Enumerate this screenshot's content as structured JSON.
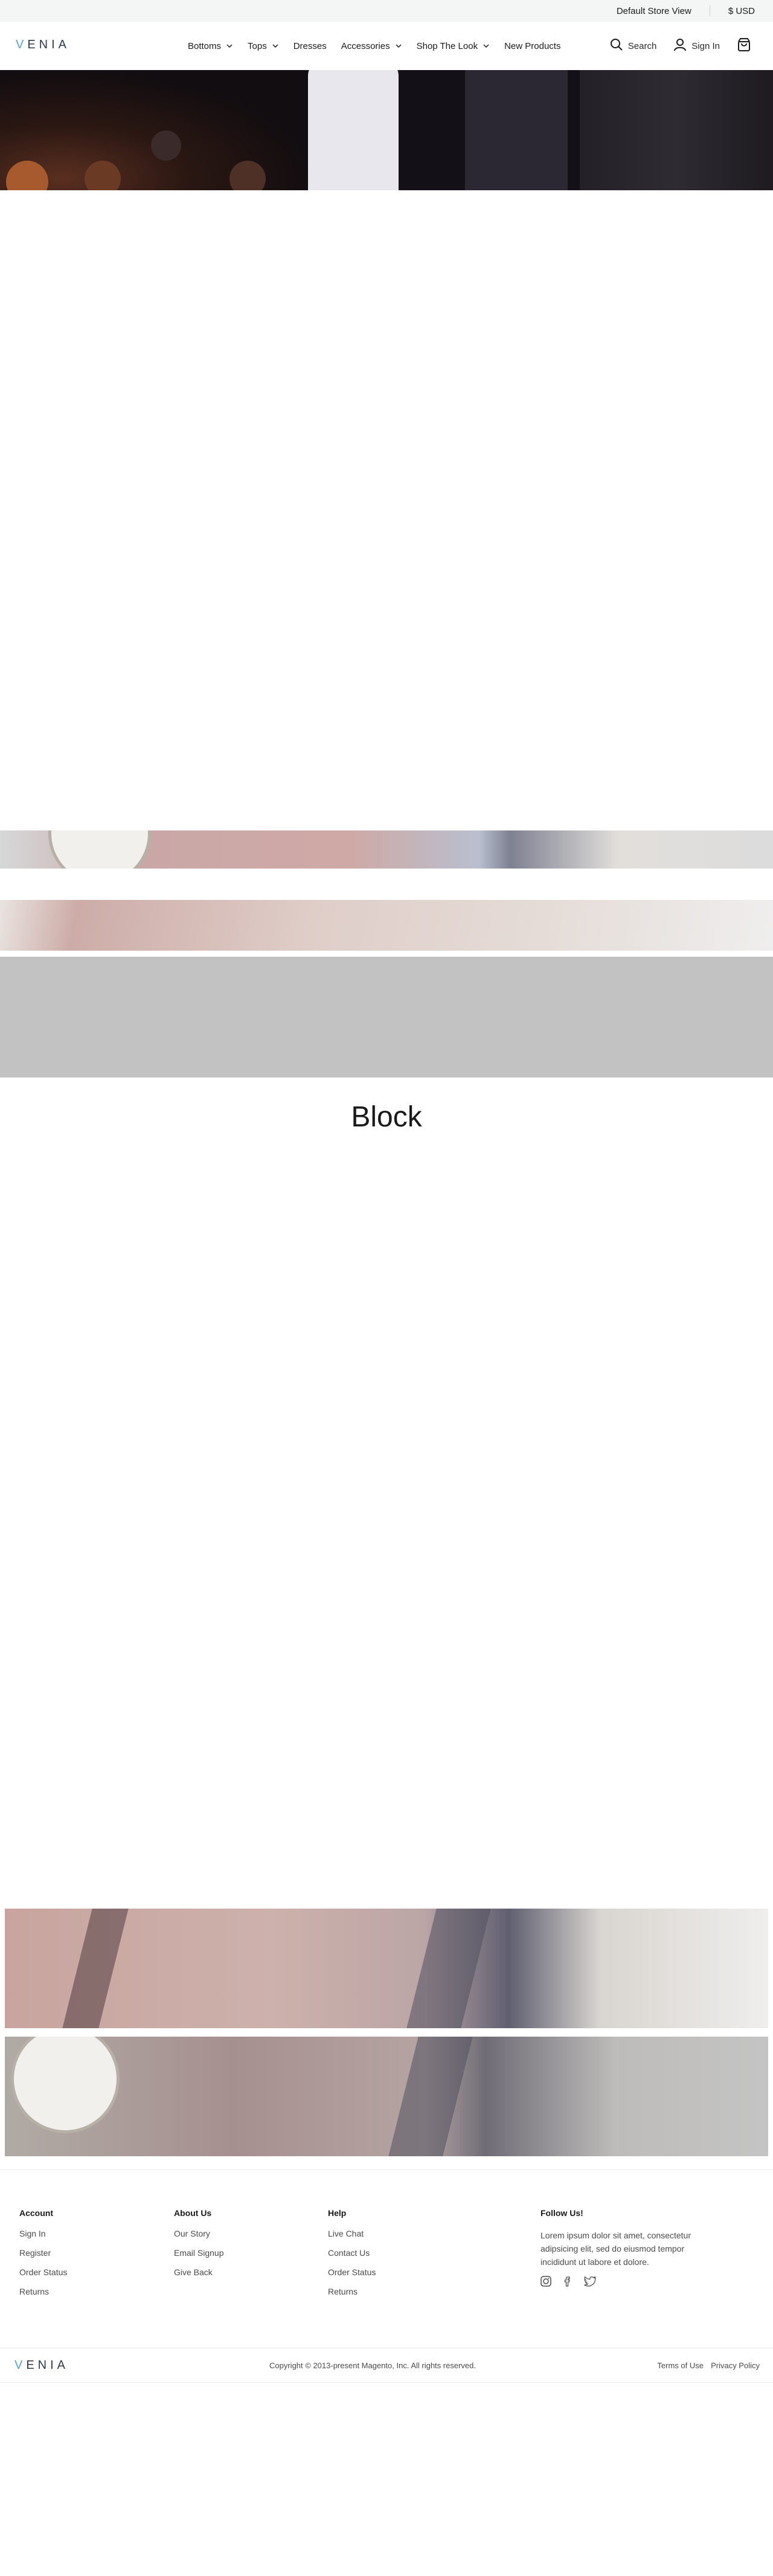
{
  "topbar": {
    "store_view": "Default Store View",
    "currency": "$ USD"
  },
  "header": {
    "logo": "VENIA",
    "nav": [
      {
        "label": "Bottoms",
        "has_dropdown": true
      },
      {
        "label": "Tops",
        "has_dropdown": true
      },
      {
        "label": "Dresses",
        "has_dropdown": false
      },
      {
        "label": "Accessories",
        "has_dropdown": true
      },
      {
        "label": "Shop The Look",
        "has_dropdown": true
      },
      {
        "label": "New Products",
        "has_dropdown": false
      }
    ],
    "search_label": "Search",
    "signin_label": "Sign In",
    "icons": [
      "search-icon",
      "user-icon",
      "shopping-bag-icon",
      "chevron-down-icon"
    ]
  },
  "main": {
    "block_title": "Block"
  },
  "footer": {
    "columns": [
      {
        "heading": "Account",
        "links": [
          "Sign In",
          "Register",
          "Order Status",
          "Returns"
        ]
      },
      {
        "heading": "About Us",
        "links": [
          "Our Story",
          "Email Signup",
          "Give Back"
        ]
      },
      {
        "heading": "Help",
        "links": [
          "Live Chat",
          "Contact Us",
          "Order Status",
          "Returns"
        ]
      }
    ],
    "follow": {
      "heading": "Follow Us!",
      "text": "Lorem ipsum dolor sit amet, consectetur adipsicing elit, sed do eiusmod tempor incididunt ut labore et dolore.",
      "icons": [
        "instagram-icon",
        "facebook-icon",
        "twitter-icon"
      ]
    },
    "logo": "VENIA",
    "copyright": "Copyright © 2013-present Magento, Inc. All rights reserved.",
    "terms": "Terms of Use",
    "privacy": "Privacy Policy"
  },
  "colors": {
    "topbar_bg": "#f4f5f5",
    "brand_accent": "#5ba0c9",
    "logo_text": "#2e3a4d",
    "placeholder_gray": "#c2c2c2"
  }
}
